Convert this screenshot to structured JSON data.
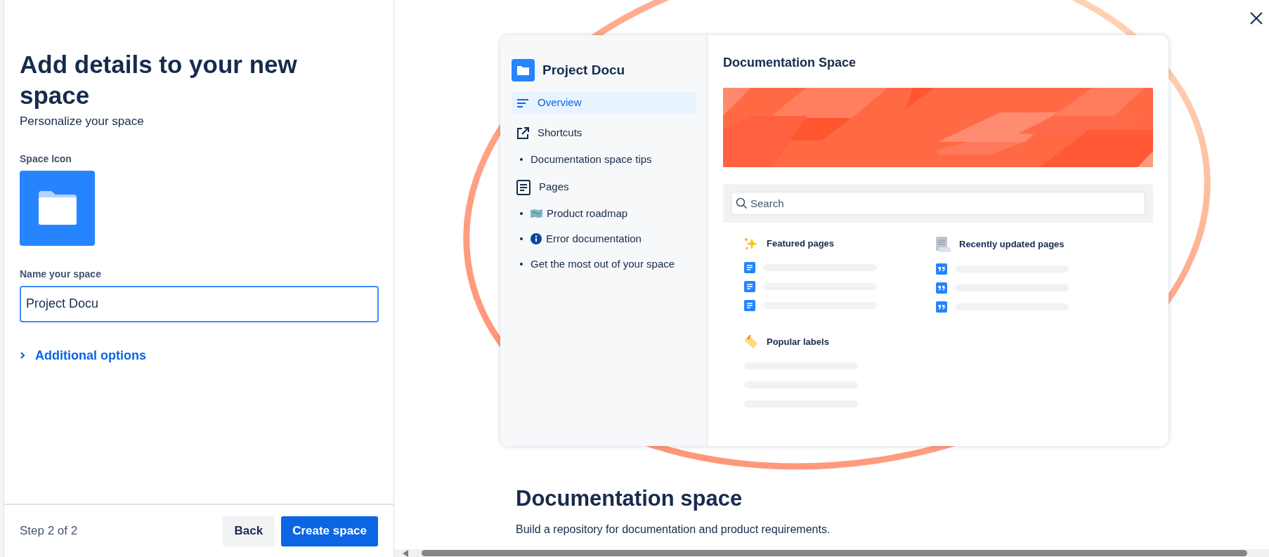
{
  "form": {
    "title": "Add details to your new space",
    "subtitle": "Personalize your space",
    "icon_label": "Space Icon",
    "name_label": "Name your space",
    "name_value": "Project Docu",
    "additional_options": "Additional options"
  },
  "footer": {
    "step": "Step 2 of 2",
    "back": "Back",
    "create": "Create space"
  },
  "preview": {
    "space_name": "Project Docu",
    "nav": [
      {
        "label": "Overview",
        "selected": true
      },
      {
        "label": "Shortcuts",
        "selected": false,
        "children": [
          {
            "label": "Documentation space tips"
          }
        ]
      },
      {
        "label": "Pages",
        "selected": false,
        "children": [
          {
            "label": "Product roadmap"
          },
          {
            "label": "Error documentation"
          },
          {
            "label": "Get the most out of your space"
          }
        ]
      }
    ],
    "title": "Documentation Space",
    "search": {
      "placeholder": "Search"
    },
    "sections": [
      {
        "title": "Featured pages"
      },
      {
        "title": "Recently updated pages"
      },
      {
        "title": "Popular labels"
      }
    ]
  },
  "template": {
    "title": "Documentation space",
    "description": "Build a repository for documentation and product requirements."
  }
}
